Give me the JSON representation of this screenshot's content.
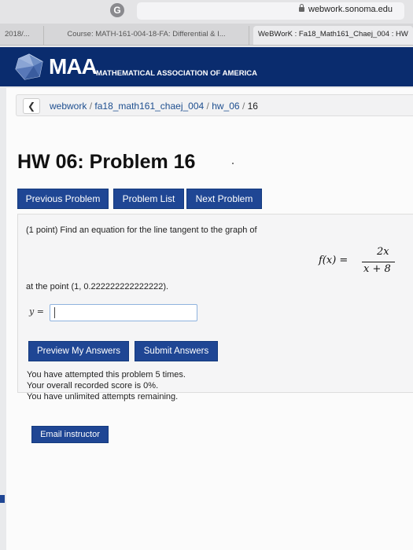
{
  "browser": {
    "address": "webwork.sonoma.edu",
    "tabs": [
      {
        "label": "2018/..."
      },
      {
        "label": "Course: MATH-161-004-18-FA: Differential & I..."
      },
      {
        "label": "WeBWorK : Fa18_Math161_Chaej_004 : HW"
      }
    ]
  },
  "header": {
    "logo_text": "MAA",
    "org_name": "MATHEMATICAL ASSOCIATION OF AMERICA",
    "brand_color": "#0a2c6e"
  },
  "breadcrumb": {
    "back_icon": "chevron-left-icon",
    "items": [
      "webwork",
      "fa18_math161_chaej_004",
      "hw_06",
      "16"
    ],
    "separator": "/"
  },
  "page": {
    "title": "HW 06: Problem 16"
  },
  "nav": {
    "previous": "Previous Problem",
    "list": "Problem List",
    "next": "Next Problem"
  },
  "problem": {
    "statement": "(1 point) Find an equation for the line tangent to the graph of",
    "formula_lhs": "f(x) =",
    "formula_numerator": "2x",
    "formula_denominator": "x + 8",
    "point_text": "at the point (1, 0.222222222222222).",
    "answer_label": "y =",
    "answer_value": ""
  },
  "actions": {
    "preview": "Preview My Answers",
    "submit": "Submit Answers",
    "email": "Email instructor"
  },
  "status": {
    "attempts": "You have attempted this problem 5 times.",
    "score": "Your overall recorded score is 0%.",
    "remaining": "You have unlimited attempts remaining."
  }
}
